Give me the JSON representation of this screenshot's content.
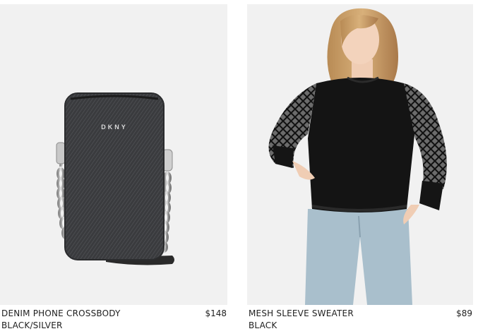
{
  "products": [
    {
      "name": "DENIM PHONE CROSSBODY",
      "color": "BLACK/SILVER",
      "price": "$148",
      "logo_text": "DKNY"
    },
    {
      "name": "MESH SLEEVE SWEATER",
      "color": "BLACK",
      "price": "$89"
    }
  ],
  "colors": {
    "image_background": "#f1f1f1",
    "text": "#1f1f1f",
    "denim": "#3a3b3e",
    "sweater": "#141414",
    "jeans": "#a9bfcc"
  }
}
